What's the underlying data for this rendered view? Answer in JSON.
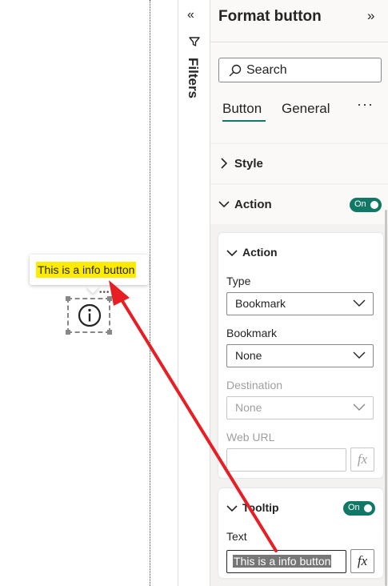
{
  "canvas": {
    "tooltip_text": "This is a info button",
    "tooltip_highlight_color": "#ffeb00",
    "more_dots": "•••"
  },
  "filters": {
    "collapse_glyph": "«",
    "label": "Filters"
  },
  "format_pane": {
    "title": "Format button",
    "expand_glyph": "»",
    "search_placeholder": "Search",
    "tabs": [
      {
        "label": "Button",
        "selected": true
      },
      {
        "label": "General",
        "selected": false
      }
    ],
    "more_glyph": "···",
    "accent_color": "#117865",
    "sections": {
      "style": {
        "label": "Style",
        "expanded": false
      },
      "action": {
        "label": "Action",
        "expanded": true,
        "toggle": "On"
      }
    },
    "action_card": {
      "title": "Action",
      "type_label": "Type",
      "type_value": "Bookmark",
      "bookmark_label": "Bookmark",
      "bookmark_value": "None",
      "destination_label": "Destination",
      "destination_value": "None",
      "web_url_label": "Web URL",
      "web_url_value": "",
      "fx_label": "fx"
    },
    "tooltip_card": {
      "title": "Tooltip",
      "toggle": "On",
      "text_label": "Text",
      "text_value": "This is a info button",
      "fx_label": "fx"
    }
  },
  "annotation": {
    "arrow_color": "#e81e25"
  }
}
